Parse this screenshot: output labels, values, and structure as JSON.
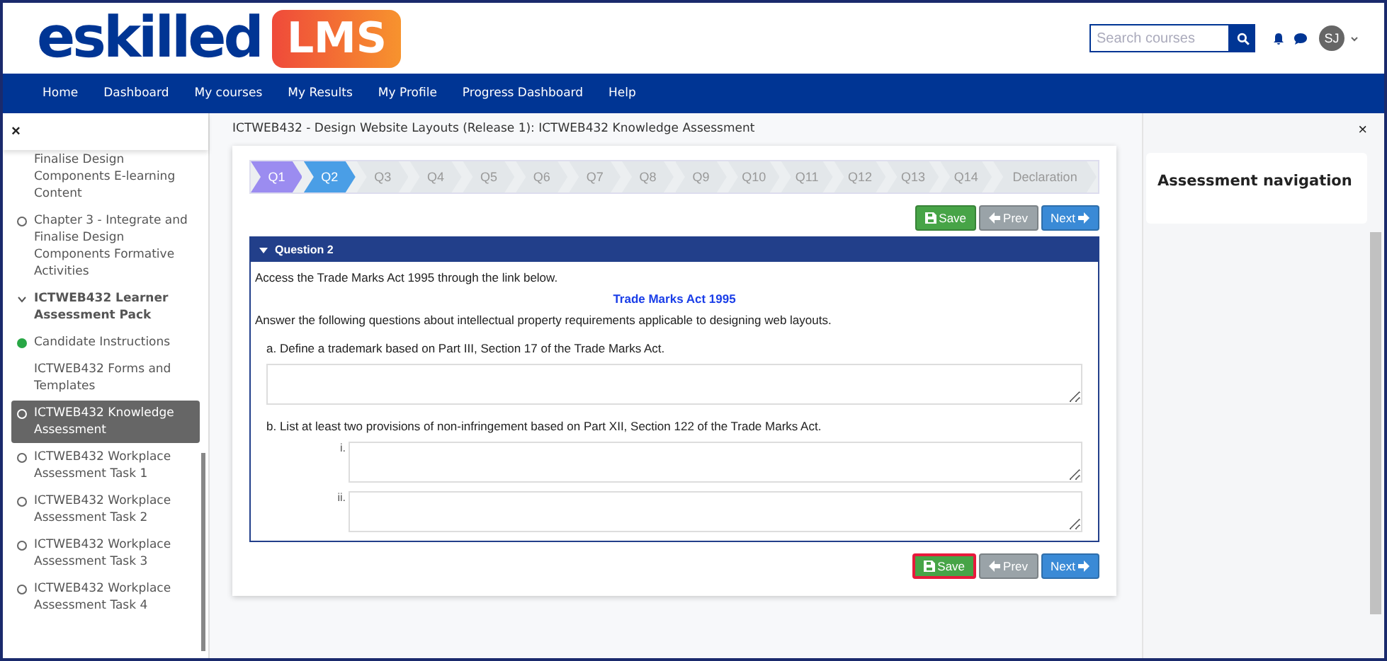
{
  "header": {
    "logo_word": "eskilled",
    "logo_badge": "LMS",
    "search": {
      "placeholder": "Search courses"
    },
    "user_initials": "SJ"
  },
  "nav": [
    "Home",
    "Dashboard",
    "My courses",
    "My Results",
    "My Profile",
    "Progress Dashboard",
    "Help"
  ],
  "sidebar": {
    "close": "×",
    "items": [
      {
        "kind": "untracked",
        "label": "Finalise Design Components E-learning Content",
        "selected": false
      },
      {
        "kind": "tracked",
        "completed": false,
        "label": "Chapter 3 - Integrate and Finalise Design Components Formative Activities",
        "selected": false
      },
      {
        "kind": "section",
        "expanded": true,
        "label": "ICTWEB432 Learner Assessment Pack",
        "selected": false
      },
      {
        "kind": "tracked",
        "completed": true,
        "label": "Candidate Instructions",
        "selected": false
      },
      {
        "kind": "untracked",
        "label": "ICTWEB432 Forms and Templates",
        "selected": false
      },
      {
        "kind": "tracked",
        "completed": false,
        "label": "ICTWEB432 Knowledge Assessment",
        "selected": true
      },
      {
        "kind": "tracked",
        "completed": false,
        "label": "ICTWEB432 Workplace Assessment Task 1",
        "selected": false
      },
      {
        "kind": "tracked",
        "completed": false,
        "label": "ICTWEB432 Workplace Assessment Task 2",
        "selected": false
      },
      {
        "kind": "tracked",
        "completed": false,
        "label": "ICTWEB432 Workplace Assessment Task 3",
        "selected": false
      },
      {
        "kind": "tracked",
        "completed": false,
        "label": "ICTWEB432 Workplace Assessment Task 4",
        "selected": false
      }
    ]
  },
  "page_title": "ICTWEB432 - Design Website Layouts (Release 1): ICTWEB432 Knowledge Assessment",
  "steps": [
    {
      "label": "Q1",
      "done": true,
      "selected": false
    },
    {
      "label": "Q2",
      "done": false,
      "selected": true
    },
    {
      "label": "Q3",
      "done": false,
      "selected": false
    },
    {
      "label": "Q4",
      "done": false,
      "selected": false
    },
    {
      "label": "Q5",
      "done": false,
      "selected": false
    },
    {
      "label": "Q6",
      "done": false,
      "selected": false
    },
    {
      "label": "Q7",
      "done": false,
      "selected": false
    },
    {
      "label": "Q8",
      "done": false,
      "selected": false
    },
    {
      "label": "Q9",
      "done": false,
      "selected": false
    },
    {
      "label": "Q10",
      "done": false,
      "selected": false
    },
    {
      "label": "Q11",
      "done": false,
      "selected": false
    },
    {
      "label": "Q12",
      "done": false,
      "selected": false
    },
    {
      "label": "Q13",
      "done": false,
      "selected": false
    },
    {
      "label": "Q14",
      "done": false,
      "selected": false
    },
    {
      "label": "Declaration",
      "done": false,
      "selected": false
    }
  ],
  "top_buttons": {
    "items": [
      {
        "kind": "save",
        "label": "Save"
      },
      {
        "kind": "prev",
        "label": "Prev"
      },
      {
        "kind": "next",
        "label": "Next"
      }
    ]
  },
  "question": {
    "title": "Question 2",
    "intro": "Access the Trade Marks Act 1995 through the link below.",
    "link": "Trade Marks Act 1995",
    "instruction": "Answer the following questions about intellectual property requirements applicable to designing web layouts.",
    "parts": [
      {
        "prompt": "a. Define a trademark based on Part III, Section 17 of the Trade Marks Act.",
        "answers": [
          {
            "kind": "plain"
          }
        ]
      },
      {
        "prompt": "b. List at least two provisions of non-infringement based on Part XII, Section 122 of the Trade Marks Act.",
        "answers": [
          {
            "kind": "numbered",
            "label": "i."
          },
          {
            "kind": "numbered",
            "label": "ii."
          }
        ]
      }
    ]
  },
  "bottom_buttons": {
    "highlighted": true,
    "items": [
      {
        "kind": "save",
        "label": "Save"
      },
      {
        "kind": "prev",
        "label": "Prev"
      },
      {
        "kind": "next",
        "label": "Next"
      }
    ]
  },
  "right_panel": {
    "close": "×",
    "title": "Assessment navigation"
  }
}
